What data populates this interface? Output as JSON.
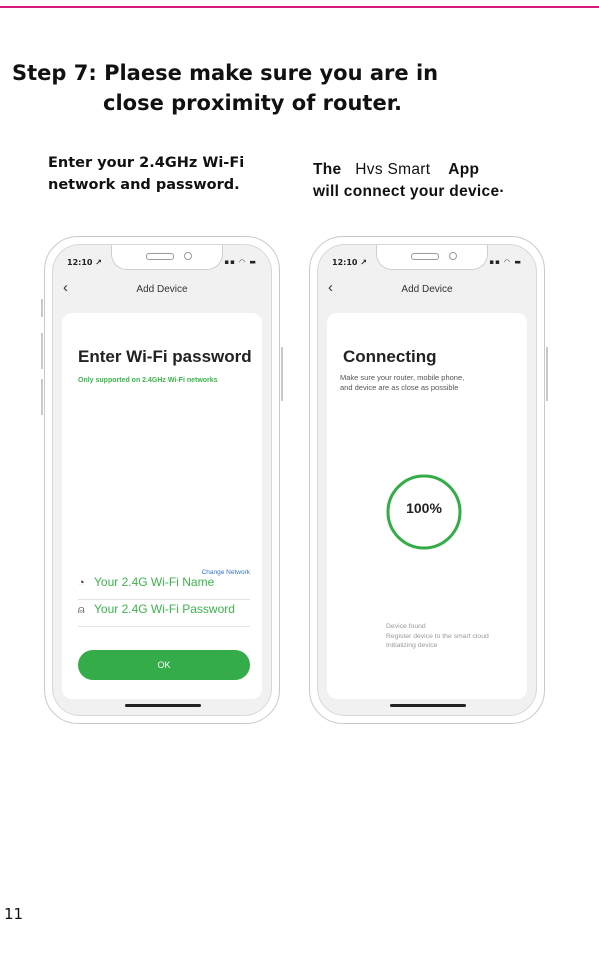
{
  "step": {
    "line1": "Step 7: Plaese make sure you are in",
    "line2": "close proximity of router."
  },
  "captions": {
    "left_line1": "Enter your 2.4GHz Wi-Fi",
    "left_line2": "network and password.",
    "right_the": "The",
    "right_hvs": "Hvs Smart",
    "right_app": "App",
    "right_line2": "will connect your device·"
  },
  "phone_left": {
    "time": "12:10 ↗",
    "nav_title": "Add Device",
    "heading": "Enter Wi-Fi password",
    "note": "Only supported on 2.4GHz Wi-Fi networks",
    "change_network": "Change Network",
    "wifi_name": "Your 2.4G Wi-Fi Name",
    "wifi_password": "Your 2.4G Wi-Fi Password",
    "ok": "OK"
  },
  "phone_right": {
    "time": "12:10 ↗",
    "nav_title": "Add Device",
    "heading": "Connecting",
    "sub_line1": "Make sure your router, mobile phone,",
    "sub_line2": "and device are as close as possible",
    "progress": "100%",
    "progress_value": 1.0,
    "step1": "Device found",
    "step2": "Register device to the smart cloud",
    "step3": "Initializing device"
  },
  "page_number": "11",
  "colors": {
    "accent_line": "#d5197a",
    "green": "#33ac49",
    "link": "#3a6fd1"
  }
}
